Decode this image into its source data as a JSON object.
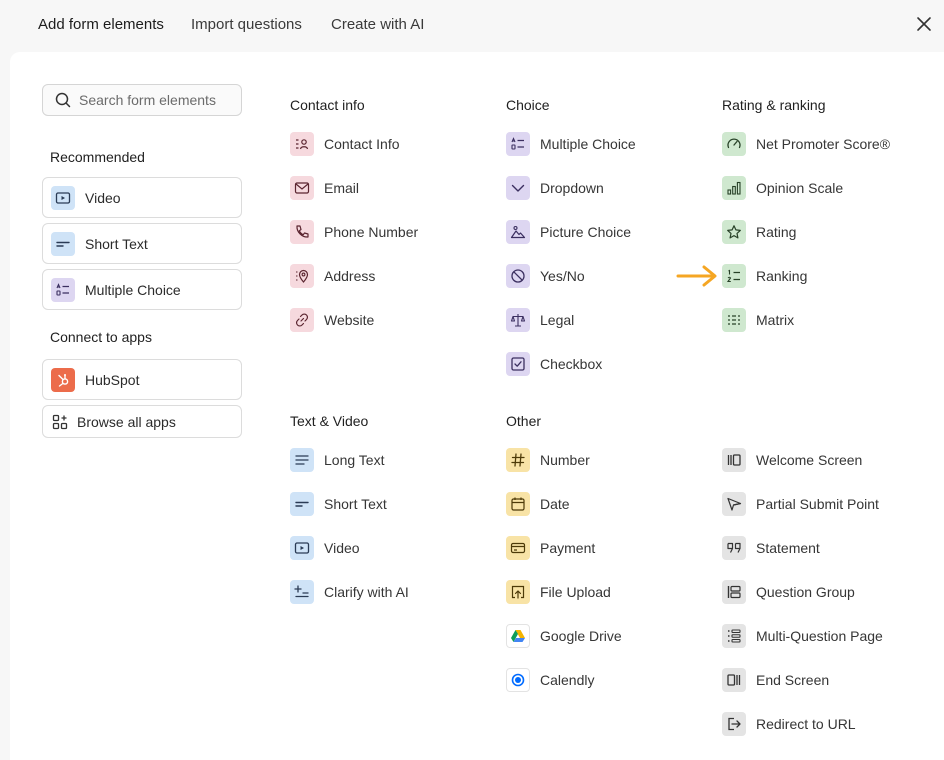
{
  "tabs": [
    {
      "label": "Add form elements"
    },
    {
      "label": "Import questions"
    },
    {
      "label": "Create with AI"
    }
  ],
  "search": {
    "placeholder": "Search form elements"
  },
  "sidebar": {
    "recommended_heading": "Recommended",
    "recommended": [
      {
        "label": "Video",
        "icon": "video-icon"
      },
      {
        "label": "Short Text",
        "icon": "short-text-icon"
      },
      {
        "label": "Multiple Choice",
        "icon": "multiple-choice-icon"
      }
    ],
    "apps_heading": "Connect to apps",
    "apps": [
      {
        "label": "HubSpot",
        "icon": "hubspot-icon"
      },
      {
        "label": "Browse all apps",
        "icon": "apps-grid-icon"
      }
    ]
  },
  "columns": {
    "contact": {
      "heading": "Contact info",
      "items": [
        {
          "label": "Contact Info"
        },
        {
          "label": "Email"
        },
        {
          "label": "Phone Number"
        },
        {
          "label": "Address"
        },
        {
          "label": "Website"
        }
      ]
    },
    "choice": {
      "heading": "Choice",
      "items": [
        {
          "label": "Multiple Choice"
        },
        {
          "label": "Dropdown"
        },
        {
          "label": "Picture Choice"
        },
        {
          "label": "Yes/No"
        },
        {
          "label": "Legal"
        },
        {
          "label": "Checkbox"
        }
      ]
    },
    "rating": {
      "heading": "Rating & ranking",
      "items": [
        {
          "label": "Net Promoter Score®"
        },
        {
          "label": "Opinion Scale"
        },
        {
          "label": "Rating"
        },
        {
          "label": "Ranking"
        },
        {
          "label": "Matrix"
        }
      ]
    },
    "textvideo": {
      "heading": "Text & Video",
      "items": [
        {
          "label": "Long Text"
        },
        {
          "label": "Short Text"
        },
        {
          "label": "Video"
        },
        {
          "label": "Clarify with AI"
        }
      ]
    },
    "other": {
      "heading": "Other",
      "items": [
        {
          "label": "Number"
        },
        {
          "label": "Date"
        },
        {
          "label": "Payment"
        },
        {
          "label": "File Upload"
        },
        {
          "label": "Google Drive"
        },
        {
          "label": "Calendly"
        }
      ]
    },
    "structure": {
      "items": [
        {
          "label": "Welcome Screen"
        },
        {
          "label": "Partial Submit Point"
        },
        {
          "label": "Statement"
        },
        {
          "label": "Question Group"
        },
        {
          "label": "Multi-Question Page"
        },
        {
          "label": "End Screen"
        },
        {
          "label": "Redirect to URL"
        }
      ]
    }
  },
  "colors": {
    "contact": "#f6d9de",
    "choice": "#ddd6f1",
    "rating": "#cfe8cf",
    "textvideo": "#cfe3f7",
    "other": "#f8e3a6",
    "structure": "#e4e4e4",
    "arrow": "#f5a623",
    "hubspot": "#ec6c4b"
  }
}
